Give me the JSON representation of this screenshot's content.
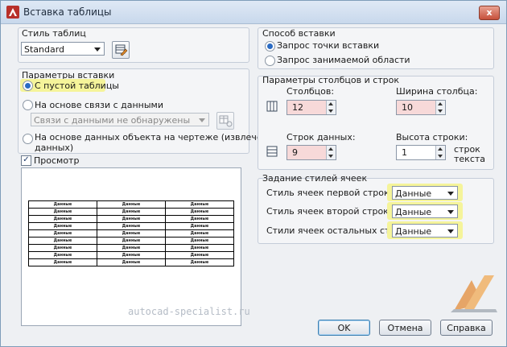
{
  "window": {
    "title": "Вставка таблицы",
    "close_label": "x"
  },
  "table_style": {
    "group_label": "Стиль таблиц",
    "selected": "Standard"
  },
  "insert_params": {
    "group_label": "Параметры вставки",
    "option_empty": "С пустой таблицы",
    "option_data_link": "На основе связи с данными",
    "data_link_combo": "Связи с данными не обнаружены",
    "option_object_data_line1": "На основе данных объекта на чертеже (извлечение",
    "option_object_data_line2": "данных)"
  },
  "preview": {
    "checkbox_label": "Просмотр",
    "cell_text": "Данные",
    "rows": 9,
    "cols": 3,
    "watermark": "autocad-specialist.ru"
  },
  "insert_method": {
    "group_label": "Способ вставки",
    "option_point": "Запрос точки вставки",
    "option_area": "Запрос занимаемой области"
  },
  "columns_rows": {
    "group_label": "Параметры столбцов и строк",
    "columns_label": "Столбцов:",
    "columns_value": "12",
    "col_width_label": "Ширина столбца:",
    "col_width_value": "10",
    "data_rows_label": "Строк данных:",
    "data_rows_value": "9",
    "row_height_label": "Высота строки:",
    "row_height_value": "1",
    "row_height_unit_line1": "строк",
    "row_height_unit_line2": "текста"
  },
  "cell_styles": {
    "group_label": "Задание стилей ячеек",
    "first_row_label": "Стиль ячеек первой строки:",
    "first_row_value": "Данные",
    "second_row_label": "Стиль ячеек второй строки:",
    "second_row_value": "Данные",
    "other_rows_label": "Стили ячеек остальных строк:",
    "other_rows_value": "Данные"
  },
  "buttons": {
    "ok": "OK",
    "cancel": "Отмена",
    "help": "Справка"
  },
  "colors": {
    "highlight": "#f5f49a",
    "spin_pink": "#f7d9d9",
    "radio_dot": "#2a6bc4"
  }
}
